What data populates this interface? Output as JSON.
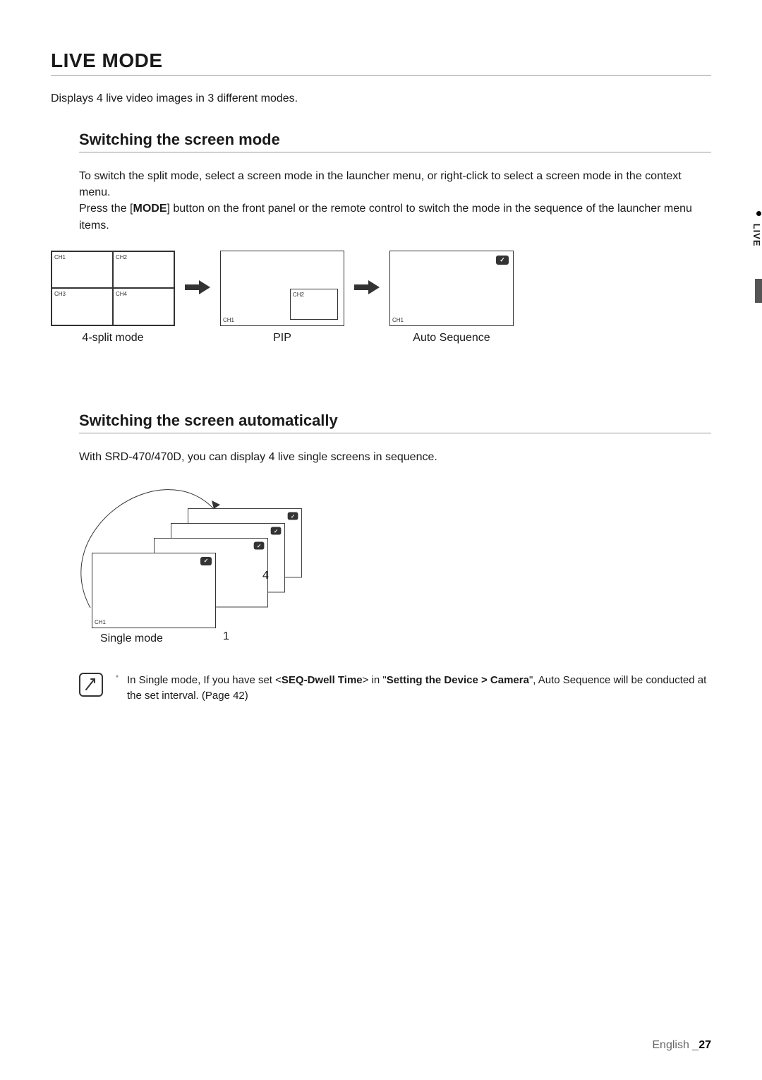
{
  "side_tab": "LIVE",
  "section_title": "LIVE MODE",
  "intro": "Displays 4 live video images in 3 different modes.",
  "sub1": {
    "title": "Switching the screen mode",
    "p1": "To switch the split mode, select a screen mode in the launcher menu, or right-click to select a screen mode in the context menu.",
    "p2a": "Press the [",
    "p2b_mode": "MODE",
    "p2c": "] button on the front panel or the remote control to switch the mode in the sequence of the launcher menu items.",
    "modes": {
      "split": "4-split mode",
      "pip": "PIP",
      "auto": "Auto Sequence"
    },
    "ch": {
      "c1": "CH1",
      "c2": "CH2",
      "c3": "CH3",
      "c4": "CH4"
    }
  },
  "sub2": {
    "title": "Switching the screen automatically",
    "p1": "With SRD-470/470D, you can display 4 live single screens in sequence.",
    "single_label": "Single mode",
    "n1": "1",
    "n4": "4",
    "ch1": "CH1"
  },
  "note": {
    "t1": "In Single mode, If you have set <",
    "t2_bold": "SEQ-Dwell Time",
    "t3": "> in \"",
    "t4_bold": "Setting the Device > Camera",
    "t5": "\", Auto Sequence will be conducted at the set interval. (Page 42)"
  },
  "footer": {
    "lang": "English _",
    "page": "27"
  }
}
